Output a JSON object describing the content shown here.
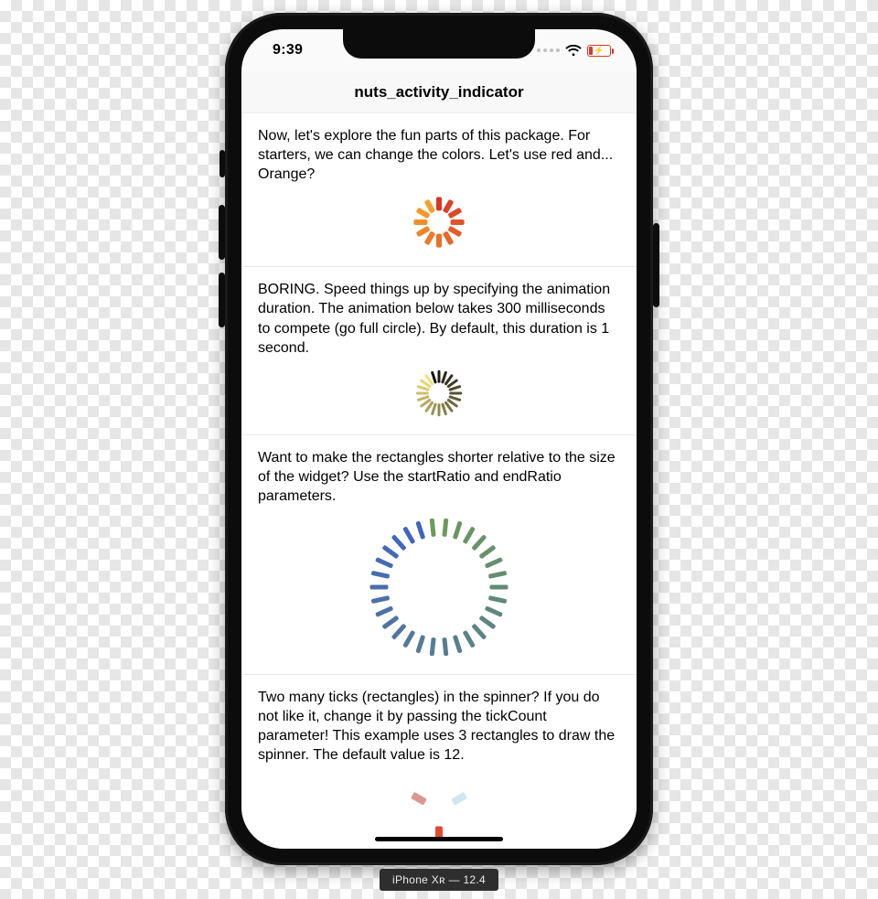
{
  "statusbar": {
    "time": "9:39"
  },
  "navbar": {
    "title": "nuts_activity_indicator"
  },
  "caption": {
    "device": "iPhone Xʀ",
    "os": "12.4"
  },
  "sections": [
    {
      "text": "Now, let's explore the fun parts of this package. For starters, we can change the colors. Let's use red and... Orange?",
      "spinner": {
        "size": 56,
        "tickCount": 12,
        "startRatio": 0.45,
        "endRatio": 1.0,
        "tickWidth": 6,
        "active": 9,
        "colorA": "#d7362a",
        "colorB": "#f5a22a"
      }
    },
    {
      "text": "BORING. Speed things up by specifying the animation duration. The animation below takes 300 milliseconds to compete (go full circle). By default, this duration is 1 second.",
      "spinner": {
        "size": 50,
        "tickCount": 20,
        "startRatio": 0.45,
        "endRatio": 1.0,
        "tickWidth": 3,
        "active": 14,
        "colorA": "#111111",
        "colorB": "#f0e07a"
      }
    },
    {
      "text": "Want to make the rectangles shorter relative to the size of the widget? Use the startRatio and endRatio parameters.",
      "spinner": {
        "size": 150,
        "tickCount": 30,
        "startRatio": 0.74,
        "endRatio": 1.0,
        "tickWidth": 5,
        "active": 22,
        "colorA": "#6f9a5a",
        "colorB": "#3f63c2"
      }
    },
    {
      "text": "Two many ticks (rectangles) in the spinner? If you do not like it, change it by passing the tickCount parameter! This example uses 3 rectangles to draw the spinner. The default value is 12.",
      "spinner": {
        "size": 70,
        "tickCount": 3,
        "startRatio": 0.5,
        "endRatio": 0.95,
        "tickWidth": 8,
        "active": 0,
        "colorA": "#e24b33",
        "colorB": "#cfe7ef",
        "angleOffset": 90
      }
    }
  ]
}
